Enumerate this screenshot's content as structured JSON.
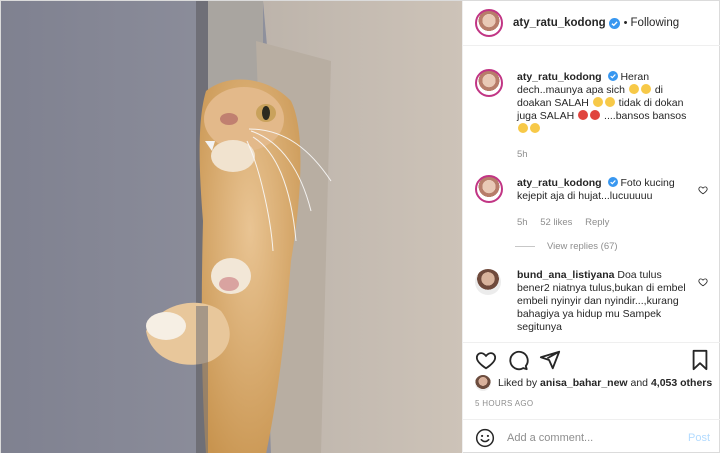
{
  "post": {
    "author": "aty_ratu_kodong",
    "follow_separator": "•",
    "follow_label": "Following"
  },
  "comments": [
    {
      "username": "aty_ratu_kodong",
      "text_1": "Heran dech..maunya apa sich",
      "text_2": "di doakan SALAH",
      "text_3": "tidak di dokan juga SALAH",
      "text_4": "....bansos bansos",
      "time": "5h"
    },
    {
      "username": "aty_ratu_kodong",
      "text": "Foto kucing kejepit aja di hujat...lucuuuuu",
      "time": "5h",
      "likes": "52 likes",
      "reply_label": "Reply",
      "view_replies": "View replies (67)"
    },
    {
      "username": "bund_ana_listiyana",
      "text": "Doa tulus bener2 niatnya tulus,bukan di embel embeli nyinyir dan nyindir...,kurang bahagiya ya hidup mu Sampek segitunya"
    }
  ],
  "liked_by": {
    "prefix": "Liked by",
    "user": "anisa_bahar_new",
    "conjunction": "and",
    "others": "4,053 others"
  },
  "timestamp": "5 HOURS AGO",
  "add_comment": {
    "placeholder": "Add a comment...",
    "post_label": "Post"
  },
  "icons": {
    "like": "heart-icon",
    "comment": "comment-icon",
    "share": "share-icon",
    "save": "bookmark-icon",
    "emoji": "emoji-icon",
    "verified": "verified-badge-icon"
  },
  "colors": {
    "verified": "#3897f0",
    "secondary_text": "#8e8e8e",
    "post_button_disabled": "#b3dbff"
  }
}
